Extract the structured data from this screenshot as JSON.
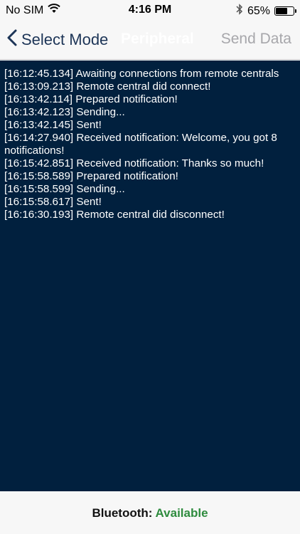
{
  "status_bar": {
    "carrier": "No SIM",
    "time": "4:16 PM",
    "battery_percent": "65%",
    "battery_level": 0.65,
    "icons": [
      "wifi-icon",
      "bluetooth-icon",
      "battery-icon"
    ]
  },
  "nav": {
    "back_label": "Select Mode",
    "title": "Peripheral",
    "action_label": "Send Data"
  },
  "log": [
    "[16:12:45.134] Awaiting connections from remote centrals",
    "[16:13:09.213] Remote central did connect!",
    "[16:13:42.114] Prepared notification!",
    "[16:13:42.123] Sending...",
    "[16:13:42.145] Sent!",
    "[16:14:27.940] Received notification: Welcome, you got 8 notifications!",
    "[16:15:42.851] Received notification: Thanks so much!",
    "[16:15:58.589] Prepared notification!",
    "[16:15:58.599] Sending...",
    "[16:15:58.617] Sent!",
    "[16:16:30.193] Remote central did disconnect!"
  ],
  "bottom": {
    "label": "Bluetooth:",
    "status": "Available"
  },
  "colors": {
    "log_background": "#01203e",
    "nav_tint": "#1d3557",
    "status_ok": "#2e8b3e"
  }
}
